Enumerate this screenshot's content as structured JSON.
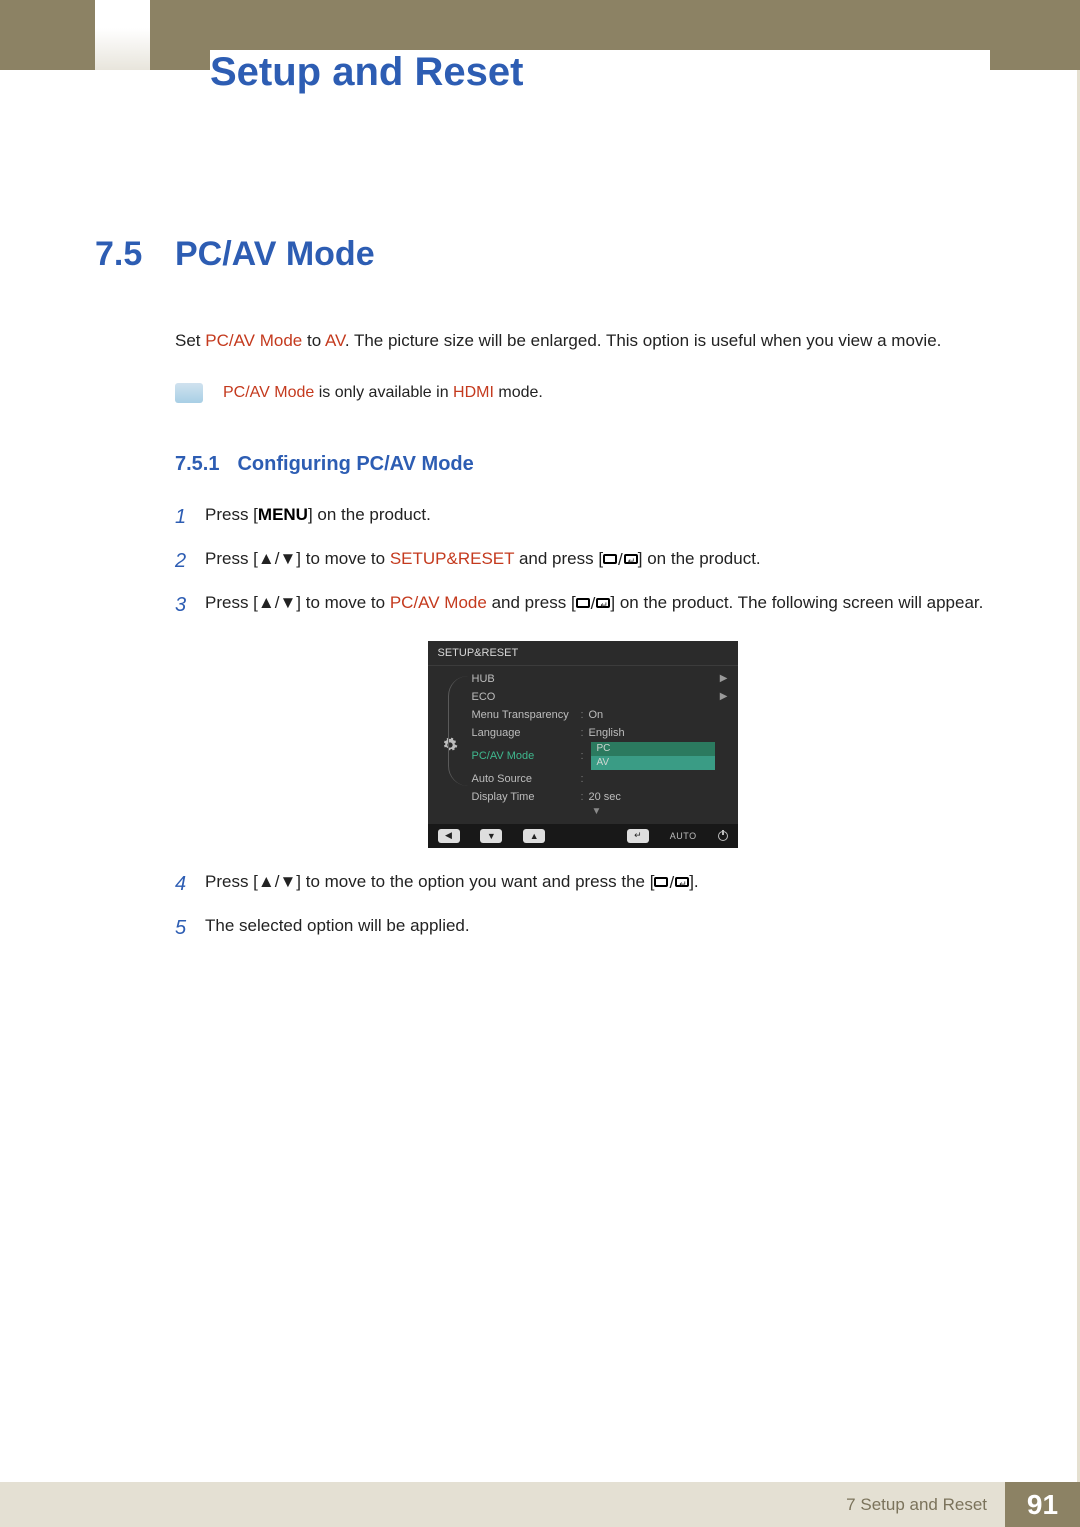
{
  "chapter_title": "Setup and Reset",
  "section": {
    "num": "7.5",
    "title": "PC/AV Mode"
  },
  "intro": {
    "prefix": "Set ",
    "em1": "PC/AV Mode",
    "mid1": " to ",
    "em2": "AV",
    "rest": ". The picture size will be enlarged. This option is useful when you view a movie."
  },
  "note": {
    "em1": "PC/AV Mode",
    "mid": " is only available in ",
    "em2": "HDMI",
    "rest": " mode."
  },
  "subsection": {
    "num": "7.5.1",
    "title": "Configuring PC/AV Mode"
  },
  "steps": {
    "s1": {
      "num": "1",
      "a": "Press [",
      "menu": "MENU",
      "b": "] on the product."
    },
    "s2": {
      "num": "2",
      "a": "Press [",
      "arrows": "▲/▼",
      "b": "] to move to ",
      "em": "SETUP&RESET",
      "c": " and press [",
      "d": "] on the product."
    },
    "s3": {
      "num": "3",
      "a": "Press [",
      "arrows": "▲/▼",
      "b": "] to move to ",
      "em": "PC/AV Mode",
      "c": " and press [",
      "d": "] on the product. The following screen will appear."
    },
    "s4": {
      "num": "4",
      "a": "Press [",
      "arrows": "▲/▼",
      "b": "] to move to the option you want and press the [",
      "c": "]."
    },
    "s5": {
      "num": "5",
      "a": "The selected option will be applied."
    }
  },
  "osd": {
    "title": "SETUP&RESET",
    "rows": {
      "hub": "HUB",
      "eco": "ECO",
      "menu_transparency": {
        "label": "Menu Transparency",
        "value": "On"
      },
      "language": {
        "label": "Language",
        "value": "English"
      },
      "pcav": {
        "label": "PC/AV Mode",
        "opt1": "PC",
        "opt2": "AV"
      },
      "auto_source": {
        "label": "Auto Source"
      },
      "display_time": {
        "label": "Display Time",
        "value": "20 sec"
      }
    },
    "footer": {
      "auto": "AUTO"
    }
  },
  "footer": {
    "chapter": "7 Setup and Reset",
    "page": "91"
  }
}
